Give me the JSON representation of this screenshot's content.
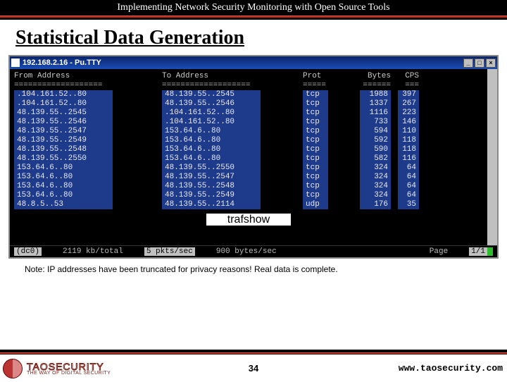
{
  "header_title": "Implementing Network Security Monitoring with Open Source Tools",
  "slide_title": "Statistical Data Generation",
  "putty_title": "192.168.2.16 - Pu.TTY",
  "term": {
    "headers": {
      "from": "From Address",
      "to": "To Address",
      "prot": "Prot",
      "bytes": "Bytes",
      "cps": "CPS"
    },
    "eq_from": "===================",
    "eq_to": "===================",
    "eq_prot": "=====",
    "eq_bytes": "======",
    "eq_cps": "===",
    "rows": [
      {
        "from": ".104.161.52..80",
        "to": "48.139.55..2545",
        "prot": "tcp",
        "bytes": "1988",
        "cps": "397"
      },
      {
        "from": ".104.161.52..80",
        "to": "48.139.55..2546",
        "prot": "tcp",
        "bytes": "1337",
        "cps": "267"
      },
      {
        "from": "48.139.55..2545",
        "to": ".104.161.52..80",
        "prot": "tcp",
        "bytes": "1116",
        "cps": "223"
      },
      {
        "from": "48.139.55..2546",
        "to": ".104.161.52..80",
        "prot": "tcp",
        "bytes": "733",
        "cps": "146"
      },
      {
        "from": "48.139.55..2547",
        "to": "153.64.6..80",
        "prot": "tcp",
        "bytes": "594",
        "cps": "110"
      },
      {
        "from": "48.139.55..2549",
        "to": "153.64.6..80",
        "prot": "tcp",
        "bytes": "592",
        "cps": "118"
      },
      {
        "from": "48.139.55..2548",
        "to": "153.64.6..80",
        "prot": "tcp",
        "bytes": "590",
        "cps": "118"
      },
      {
        "from": "48.139.55..2550",
        "to": "153.64.6..80",
        "prot": "tcp",
        "bytes": "582",
        "cps": "116"
      },
      {
        "from": "153.64.6..80",
        "to": "48.139.55..2550",
        "prot": "tcp",
        "bytes": "324",
        "cps": "64"
      },
      {
        "from": "153.64.6..80",
        "to": "48.139.55..2547",
        "prot": "tcp",
        "bytes": "324",
        "cps": "64"
      },
      {
        "from": "153.64.6..80",
        "to": "48.139.55..2548",
        "prot": "tcp",
        "bytes": "324",
        "cps": "64"
      },
      {
        "from": "153.64.6..80",
        "to": "48.139.55..2549",
        "prot": "tcp",
        "bytes": "324",
        "cps": "64"
      },
      {
        "from": "48.8.5..53",
        "to": "48.139.55..2114",
        "prot": "udp",
        "bytes": "176",
        "cps": "35"
      }
    ]
  },
  "tool_label": "trafshow",
  "status": {
    "iface": "(dc0)",
    "rate": "2119 kb/total",
    "pkts": "5 pkts/sec",
    "bps": "900 bytes/sec",
    "page_lbl": "Page",
    "page_val": "1/1"
  },
  "note": "Note: IP addresses have been truncated for privacy reasons!  Real data is complete.",
  "logo": {
    "name": "TAOSECURITY",
    "tag": "THE WAY OF DIGITAL SECURITY"
  },
  "page_number": "34",
  "url": "www.taosecurity.com"
}
